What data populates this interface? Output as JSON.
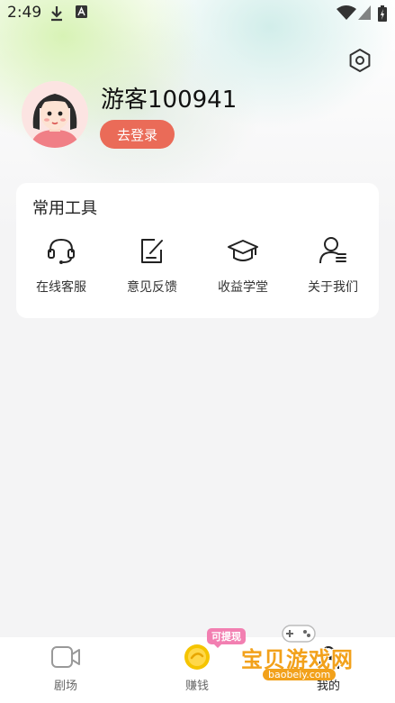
{
  "status_bar": {
    "time": "2:49"
  },
  "profile": {
    "username": "游客100941",
    "login_label": "去登录"
  },
  "tools": {
    "title": "常用工具",
    "items": [
      {
        "label": "在线客服",
        "icon": "headset-icon"
      },
      {
        "label": "意见反馈",
        "icon": "feedback-icon"
      },
      {
        "label": "收益学堂",
        "icon": "graduation-cap-icon"
      },
      {
        "label": "关于我们",
        "icon": "about-user-icon"
      }
    ]
  },
  "tab_bar": {
    "tabs": [
      {
        "label": "剧场",
        "icon": "video-camera-icon"
      },
      {
        "label": "赚钱",
        "icon": "coin-icon"
      },
      {
        "label": "我的",
        "icon": "profile-icon"
      }
    ],
    "badge": "可提现"
  },
  "watermark": {
    "brand": "宝贝游戏网",
    "url": "baobeiy.com"
  },
  "colors": {
    "accent": "#ea6b58",
    "badge": "#f27fb1",
    "coin": "#f5c400"
  }
}
